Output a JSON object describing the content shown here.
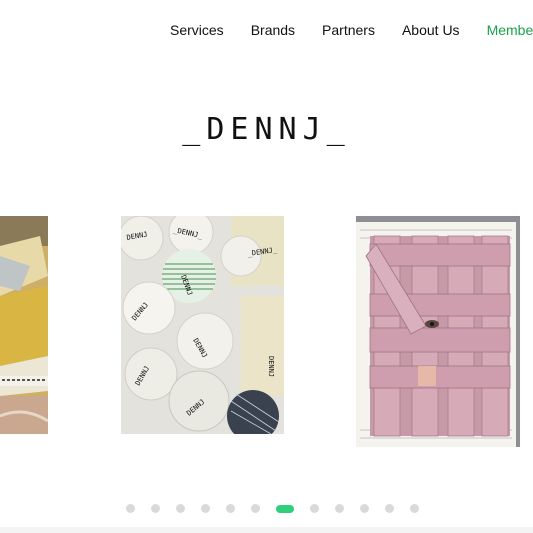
{
  "nav": {
    "items": [
      {
        "label": "Services"
      },
      {
        "label": "Brands"
      },
      {
        "label": "Partners"
      },
      {
        "label": "About Us"
      },
      {
        "label": "Member Area"
      }
    ]
  },
  "logo": {
    "text": "_DENNJ_"
  },
  "carousel": {
    "slides": [
      {
        "name": "textile-slide-left"
      },
      {
        "name": "dennj-labels-slide"
      },
      {
        "name": "woven-pink-fabric-slide"
      }
    ],
    "active_index": 6,
    "dot_count": 12
  },
  "colors": {
    "accent": "#1aa24a",
    "active_dot": "#2fcf7b",
    "inactive_dot": "#d9d9d9"
  }
}
